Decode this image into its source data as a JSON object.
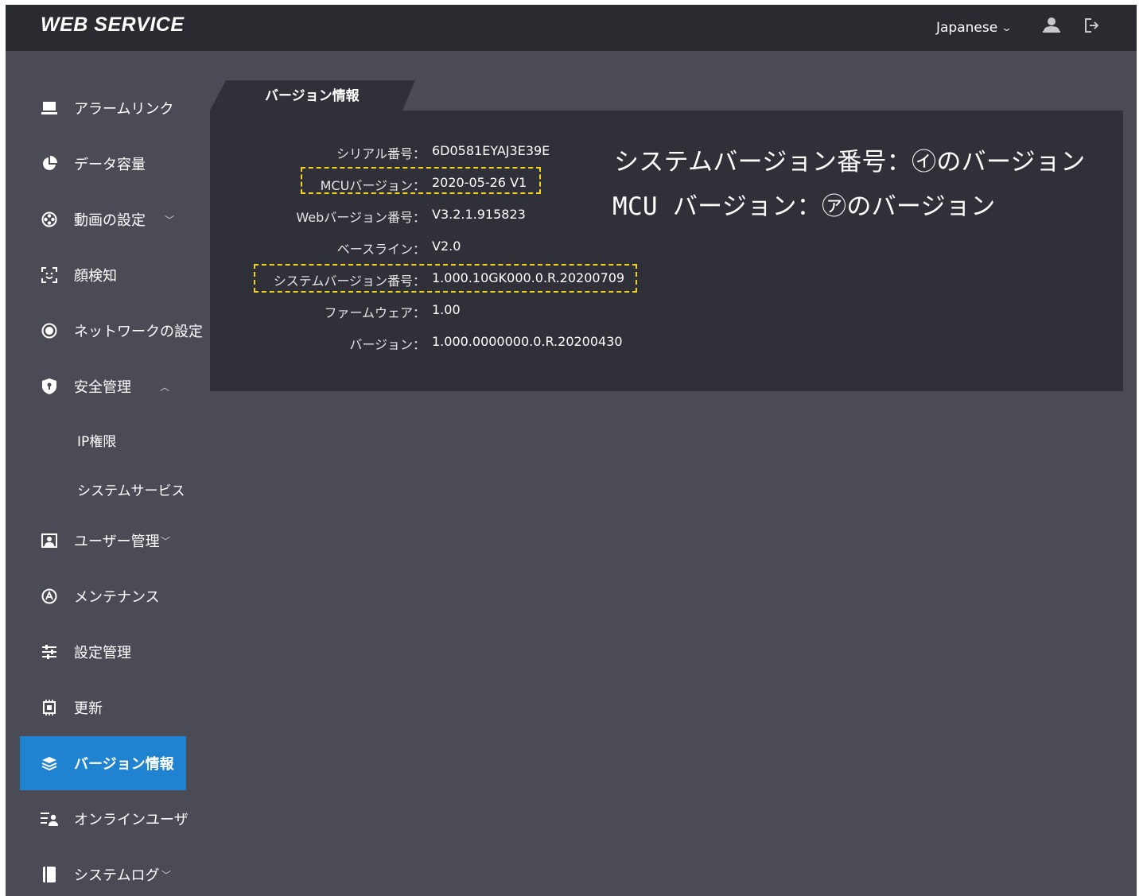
{
  "header": {
    "logo": "WEB SERVICE",
    "language": "Japanese"
  },
  "sidebar": {
    "items": [
      {
        "label": "アラームリンク",
        "icon": "monitor-icon"
      },
      {
        "label": "データ容量",
        "icon": "pie-chart-icon"
      },
      {
        "label": "動画の設定",
        "icon": "film-reel-icon",
        "caret": "down"
      },
      {
        "label": "顔検知",
        "icon": "face-scan-icon"
      },
      {
        "label": "ネットワークの設定",
        "icon": "network-globe-icon"
      },
      {
        "label": "安全管理",
        "icon": "shield-icon",
        "caret": "up"
      },
      {
        "label": "ユーザー管理",
        "icon": "user-card-icon",
        "caret": "down"
      },
      {
        "label": "メンテナンス",
        "icon": "maintenance-icon"
      },
      {
        "label": "設定管理",
        "icon": "sliders-icon"
      },
      {
        "label": "更新",
        "icon": "chip-icon"
      },
      {
        "label": "バージョン情報",
        "icon": "layers-icon",
        "active": true
      },
      {
        "label": "オンラインユーザ",
        "icon": "online-users-icon"
      },
      {
        "label": "システムログ",
        "icon": "log-book-icon",
        "caret": "down"
      }
    ],
    "sub_items": [
      "IP権限",
      "システムサービス"
    ]
  },
  "content": {
    "tab_label": "バージョン情報",
    "rows": [
      {
        "key": "シリアル番号：",
        "value": "6D0581EYAJ3E39E"
      },
      {
        "key": "MCUバージョン：",
        "value": "2020-05-26 V1"
      },
      {
        "key": "Webバージョン番号：",
        "value": "V3.2.1.915823"
      },
      {
        "key": "ベースライン：",
        "value": "V2.0"
      },
      {
        "key": "システムバージョン番号：",
        "value": "1.000.10GK000.0.R.20200709"
      },
      {
        "key": "ファームウェア：",
        "value": "1.00"
      },
      {
        "key": "バージョン：",
        "value": "1.000.0000000.0.R.20200430"
      }
    ]
  },
  "annotations": {
    "line1": "システムバージョン番号：㋑のバージョン",
    "line2": "MCU バージョン：㋐のバージョン",
    "highlight_color": "#f2d41f"
  },
  "colors": {
    "topbar": "#2a2b30",
    "background": "#4b4b56",
    "panel": "#2f3038",
    "active": "#1f83d1"
  }
}
